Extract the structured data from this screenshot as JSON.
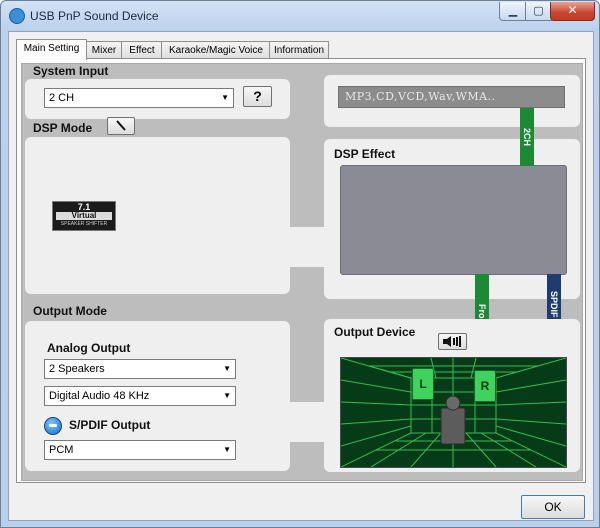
{
  "window": {
    "title": "USB PnP Sound Device",
    "min_glyph": "▁",
    "max_glyph": "▢",
    "close_glyph": "✕"
  },
  "tabs": [
    {
      "label": "Main Setting",
      "active": true
    },
    {
      "label": "Mixer",
      "active": false
    },
    {
      "label": "Effect",
      "active": false
    },
    {
      "label": "Karaoke/Magic Voice",
      "active": false
    },
    {
      "label": "Information",
      "active": false
    }
  ],
  "system_input": {
    "label": "System Input",
    "channel_value": "2 CH",
    "help_label": "?",
    "input_display": "MP3,CD,VCD,Wav,WMA..",
    "bar_label": "2CH"
  },
  "dsp_mode": {
    "label": "DSP Mode",
    "badge_top": "7.1",
    "badge_mid": "Virtual",
    "badge_bottom": "SPEAKER SHIFTER"
  },
  "dsp_effect": {
    "label": "DSP Effect"
  },
  "output_mode": {
    "label": "Output Mode",
    "analog_label": "Analog Output",
    "speakers_value": "2 Speakers",
    "audio_value": "Digital Audio 48 KHz",
    "spdif_label": "S/PDIF Output",
    "spdif_value": "PCM"
  },
  "output_device": {
    "label": "Output Device",
    "front_label": "Front",
    "spdif_out_label": "SPDIF OUT",
    "left_speaker": "L",
    "right_speaker": "R"
  },
  "footer": {
    "ok_label": "OK"
  },
  "colors": {
    "green_bar": "#1c8a34",
    "blue_bar": "#1d3c6f",
    "room_green": "#3fd35e"
  }
}
